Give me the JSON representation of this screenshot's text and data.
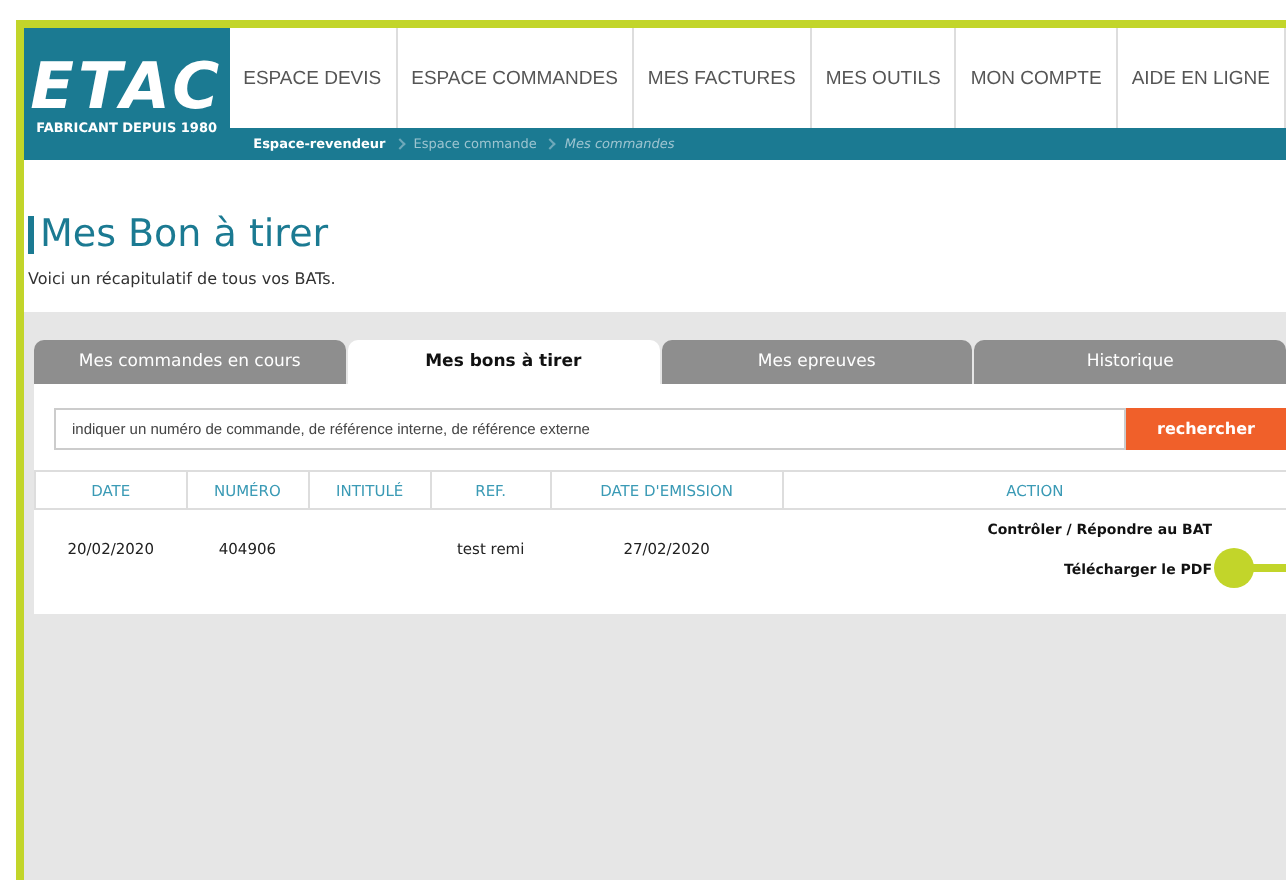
{
  "logo": {
    "brand": "ETAC",
    "tagline": "FABRICANT DEPUIS 1980"
  },
  "nav": [
    "ESPACE DEVIS",
    "ESPACE COMMANDES",
    "MES FACTURES",
    "MES OUTILS",
    "MON COMPTE",
    "AIDE EN LIGNE"
  ],
  "breadcrumb": [
    {
      "label": "Espace-revendeur",
      "kind": "current"
    },
    {
      "label": "Espace commande",
      "kind": "link"
    },
    {
      "label": "Mes commandes",
      "kind": "page"
    }
  ],
  "page": {
    "title": "Mes Bon à tirer",
    "subtitle": "Voici un récapitulatif de tous vos BATs."
  },
  "tabs": [
    {
      "label": "Mes commandes en cours",
      "selected": false
    },
    {
      "label": "Mes bons à tirer",
      "selected": true
    },
    {
      "label": "Mes epreuves",
      "selected": false
    },
    {
      "label": "Historique",
      "selected": false
    }
  ],
  "search": {
    "placeholder": "indiquer un numéro de commande, de référence interne, de référence externe",
    "button": "rechercher"
  },
  "table": {
    "columns": [
      "DATE",
      "NUMÉRO",
      "INTITULÉ",
      "REF.",
      "DATE D'EMISSION",
      "ACTION"
    ],
    "rows": [
      {
        "cells": [
          "20/02/2020",
          "404906",
          "",
          "test remi",
          "27/02/2020"
        ],
        "actions": [
          "Contrôler / Répondre au BAT",
          "Télécharger le PDF"
        ],
        "callout": true
      }
    ]
  }
}
